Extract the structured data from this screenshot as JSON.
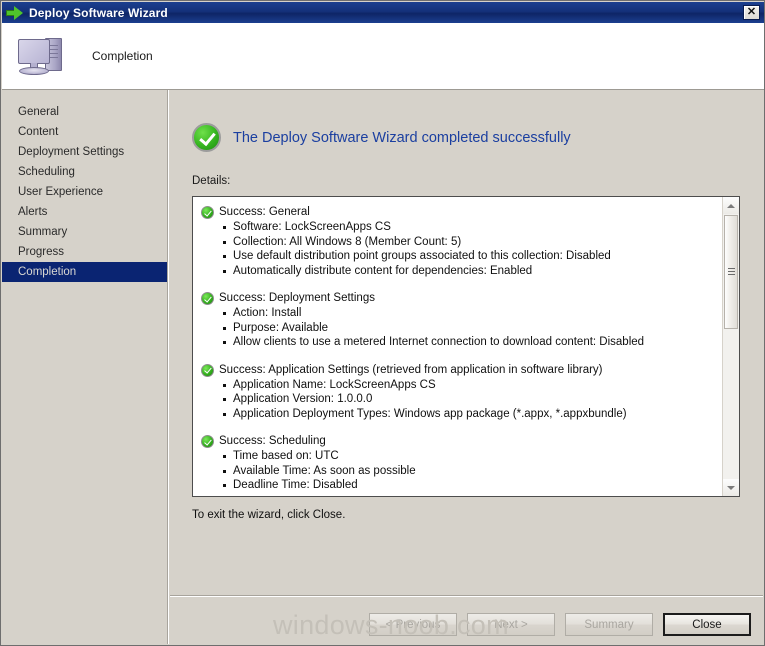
{
  "window": {
    "title": "Deploy Software Wizard",
    "close_label": "✕",
    "icon": "green-arrow-icon"
  },
  "header": {
    "page_name": "Completion",
    "icon": "computer-icon"
  },
  "sidebar": {
    "items": [
      {
        "label": "General",
        "selected": false
      },
      {
        "label": "Content",
        "selected": false
      },
      {
        "label": "Deployment Settings",
        "selected": false
      },
      {
        "label": "Scheduling",
        "selected": false
      },
      {
        "label": "User Experience",
        "selected": false
      },
      {
        "label": "Alerts",
        "selected": false
      },
      {
        "label": "Summary",
        "selected": false
      },
      {
        "label": "Progress",
        "selected": false
      },
      {
        "label": "Completion",
        "selected": true
      }
    ]
  },
  "main": {
    "success_heading": "The Deploy Software Wizard completed successfully",
    "success_icon": "green-check-icon",
    "details_label": "Details:",
    "exit_text": "To exit the wizard, click Close.",
    "details": [
      {
        "title": "Success: General",
        "bullets": [
          "Software: LockScreenApps CS",
          "Collection: All Windows 8 (Member Count: 5)",
          "Use default distribution point groups associated to this collection: Disabled",
          "Automatically distribute content for dependencies: Enabled"
        ]
      },
      {
        "title": "Success: Deployment Settings",
        "bullets": [
          "Action: Install",
          "Purpose: Available",
          "Allow clients to use a metered Internet connection to download content: Disabled"
        ]
      },
      {
        "title": "Success: Application Settings (retrieved from application in software library)",
        "bullets": [
          "Application Name: LockScreenApps CS",
          "Application Version: 1.0.0.0",
          "Application Deployment Types: Windows app package (*.appx, *.appxbundle)"
        ]
      },
      {
        "title": "Success: Scheduling",
        "bullets": [
          "Time based on: UTC",
          "Available Time: As soon as possible",
          "Deadline Time: Disabled"
        ]
      },
      {
        "title": "",
        "bullets": []
      }
    ]
  },
  "footer": {
    "buttons": [
      {
        "label": "< Previous",
        "state": "disabled"
      },
      {
        "label": "Next >",
        "state": "disabled"
      },
      {
        "label": "Summary",
        "state": "disabled"
      },
      {
        "label": "Close",
        "state": "default"
      }
    ]
  },
  "watermark": {
    "text": "windows-noob.com"
  },
  "colors": {
    "titlebar_blue": "#14317a",
    "heading_blue": "#1b3fa0",
    "selection_navy": "#0a2472",
    "window_gray": "#d6d2ca",
    "success_green": "#35b41f"
  }
}
